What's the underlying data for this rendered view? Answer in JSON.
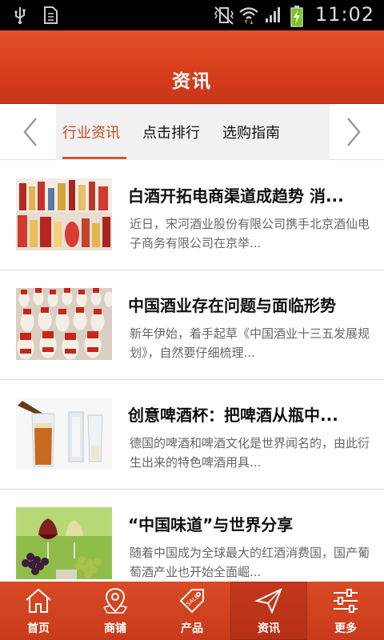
{
  "status_bar": {
    "time": "11:02",
    "icons": [
      "usb-icon",
      "sim-card-icon",
      "vibrate-mute-icon",
      "wifi-icon",
      "signal-icon",
      "battery-charging-icon"
    ]
  },
  "header": {
    "title": "资讯"
  },
  "tabs": {
    "items": [
      {
        "label": "行业资讯",
        "active": true
      },
      {
        "label": "点击排行",
        "active": false
      },
      {
        "label": "选购指南",
        "active": false
      }
    ],
    "prev_icon": "chevron-left-icon",
    "next_icon": "chevron-right-icon"
  },
  "news": [
    {
      "title": "白酒开拓电商渠道成趋势 消...",
      "summary": "近日，宋河酒业股份有限公司携手北京酒仙电子商务有限公司在京举..."
    },
    {
      "title": "中国酒业存在问题与面临形势",
      "summary": "新年伊始，着手起草《中国酒业十三五发展规划》，自然要仔细梳理..."
    },
    {
      "title": "创意啤酒杯：把啤酒从瓶中...",
      "summary": "德国的啤酒和啤酒文化是世界闻名的，由此衍生出来的特色啤酒用具..."
    },
    {
      "title": "“中国味道”与世界分享",
      "summary": "随着中国成为全球最大的红酒消费国，国产葡萄酒产业也开始全面崛..."
    }
  ],
  "bottom_nav": {
    "items": [
      {
        "label": "首页",
        "icon": "home-icon",
        "active": false
      },
      {
        "label": "商铺",
        "icon": "map-pin-icon",
        "active": false
      },
      {
        "label": "产品",
        "icon": "sale-tag-icon",
        "active": false
      },
      {
        "label": "资讯",
        "icon": "paper-plane-icon",
        "active": true
      },
      {
        "label": "更多",
        "icon": "sliders-icon",
        "active": false
      }
    ]
  },
  "colors": {
    "brand": "#d8451f",
    "active_tab": "#c9481f"
  }
}
